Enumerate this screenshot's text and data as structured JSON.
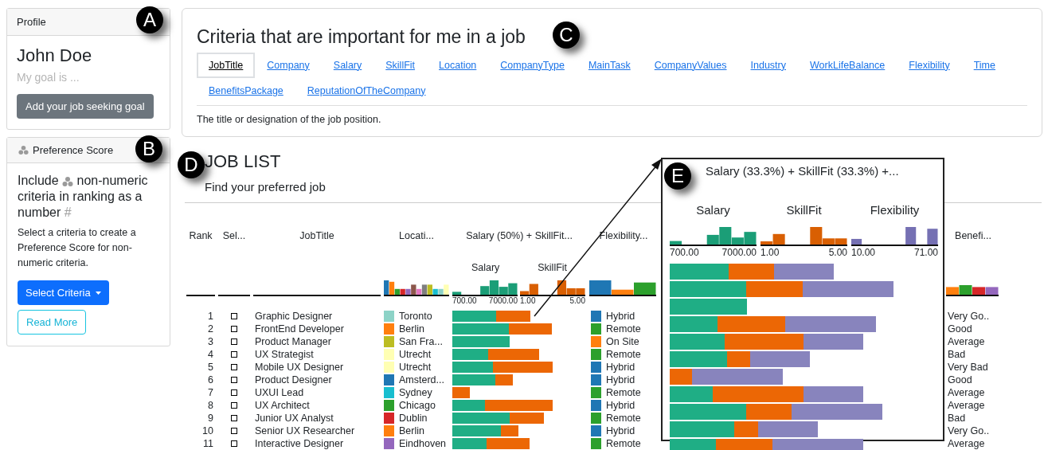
{
  "profile": {
    "header": "Profile",
    "name": "John Doe",
    "goal": "My goal is ...",
    "button": "Add your job seeking goal"
  },
  "preference": {
    "header": "Preference Score",
    "heading_start": "Include",
    "heading_end": "non-numeric criteria in ranking as a number",
    "heading_mark": "#",
    "text": "Select a criteria to create a Preference Score for non-numeric criteria.",
    "select_button": "Select Criteria",
    "read_more": "Read More"
  },
  "criteria": {
    "title": "Criteria that are important for me in a job",
    "tabs": [
      {
        "label": "JobTitle",
        "selected": true
      },
      {
        "label": "Company",
        "selected": false
      },
      {
        "label": "Salary",
        "selected": false
      },
      {
        "label": "SkillFit",
        "selected": false
      },
      {
        "label": "Location",
        "selected": false
      },
      {
        "label": "CompanyType",
        "selected": false
      },
      {
        "label": "MainTask",
        "selected": false
      },
      {
        "label": "CompanyValues",
        "selected": false
      },
      {
        "label": "Industry",
        "selected": false
      },
      {
        "label": "WorkLifeBalance",
        "selected": false
      },
      {
        "label": "Flexibility",
        "selected": false
      },
      {
        "label": "Time",
        "selected": false
      },
      {
        "label": "BenefitsPackage",
        "selected": false
      },
      {
        "label": "ReputationOfTheCompany",
        "selected": false
      }
    ],
    "description": "The title or designation of the job position."
  },
  "job_list": {
    "title": "JOB LIST",
    "subtitle": "Find your preferred job",
    "columns": {
      "rank": "Rank",
      "select": "Sel...",
      "title": "JobTitle",
      "location": "Locati...",
      "score": "Salary (50%) + SkillFit...",
      "flexibility": "Flexibility...",
      "benefits": "Benefi..."
    },
    "score_parts": [
      {
        "label": "Salary",
        "ticks": [
          "700.00",
          "7000.00"
        ]
      },
      {
        "label": "SkillFit",
        "ticks": [
          "1.00",
          "5.00"
        ]
      }
    ],
    "rows": [
      {
        "rank": "1",
        "checked": false,
        "title": "Graphic Designer",
        "location": {
          "text": "Toronto",
          "color": "#8dd3c7"
        },
        "flexibility": {
          "text": "Hybrid",
          "color": "#1f77b4"
        },
        "benefit": "Very Go.."
      },
      {
        "rank": "2",
        "checked": false,
        "title": "FrontEnd Developer",
        "location": {
          "text": "Berlin",
          "color": "#ff7f0e"
        },
        "flexibility": {
          "text": "Remote",
          "color": "#2ca02c"
        },
        "benefit": "Good"
      },
      {
        "rank": "3",
        "checked": false,
        "title": "Product Manager",
        "location": {
          "text": "San Fra...",
          "color": "#bcbd22"
        },
        "flexibility": {
          "text": "On Site",
          "color": "#ff7f0e"
        },
        "benefit": "Average"
      },
      {
        "rank": "4",
        "checked": false,
        "title": "UX Strategist",
        "location": {
          "text": "Utrecht",
          "color": "#ffffb3"
        },
        "flexibility": {
          "text": "Remote",
          "color": "#2ca02c"
        },
        "benefit": "Bad"
      },
      {
        "rank": "5",
        "checked": false,
        "title": "Mobile UX Designer",
        "location": {
          "text": "Utrecht",
          "color": "#ffffb3"
        },
        "flexibility": {
          "text": "Hybrid",
          "color": "#1f77b4"
        },
        "benefit": "Very Bad"
      },
      {
        "rank": "6",
        "checked": false,
        "title": "Product Designer",
        "location": {
          "text": "Amsterd...",
          "color": "#1f77b4"
        },
        "flexibility": {
          "text": "Hybrid",
          "color": "#1f77b4"
        },
        "benefit": "Good"
      },
      {
        "rank": "7",
        "checked": false,
        "title": "UXUI Lead",
        "location": {
          "text": "Sydney",
          "color": "#17becf"
        },
        "flexibility": {
          "text": "Remote",
          "color": "#2ca02c"
        },
        "benefit": "Average"
      },
      {
        "rank": "8",
        "checked": false,
        "title": "UX Architect",
        "location": {
          "text": "Chicago",
          "color": "#2ca02c"
        },
        "flexibility": {
          "text": "Hybrid",
          "color": "#1f77b4"
        },
        "benefit": "Average"
      },
      {
        "rank": "9",
        "checked": false,
        "title": "Junior UX Analyst",
        "location": {
          "text": "Dublin",
          "color": "#d62728"
        },
        "flexibility": {
          "text": "Remote",
          "color": "#2ca02c"
        },
        "benefit": "Bad"
      },
      {
        "rank": "10",
        "checked": false,
        "title": "Senior UX Researcher",
        "location": {
          "text": "Berlin",
          "color": "#ff7f0e"
        },
        "flexibility": {
          "text": "Hybrid",
          "color": "#1f77b4"
        },
        "benefit": "Very Go.."
      },
      {
        "rank": "11",
        "checked": false,
        "title": "Interactive Designer",
        "location": {
          "text": "Eindhoven",
          "color": "#9467bd"
        },
        "flexibility": {
          "text": "Remote",
          "color": "#2ca02c"
        },
        "benefit": "Average"
      }
    ]
  },
  "overlay": {
    "title": "Salary (33.3%) + SkillFit (33.3%) +...",
    "parts": [
      {
        "label": "Salary",
        "ticks": [
          "700.00",
          "7000.00"
        ]
      },
      {
        "label": "SkillFit",
        "ticks": [
          "1.00",
          "5.00"
        ]
      },
      {
        "label": "Flexibility",
        "ticks": [
          "10.00",
          "71.00"
        ]
      }
    ]
  },
  "callouts": [
    "A",
    "B",
    "C",
    "D",
    "E"
  ]
}
